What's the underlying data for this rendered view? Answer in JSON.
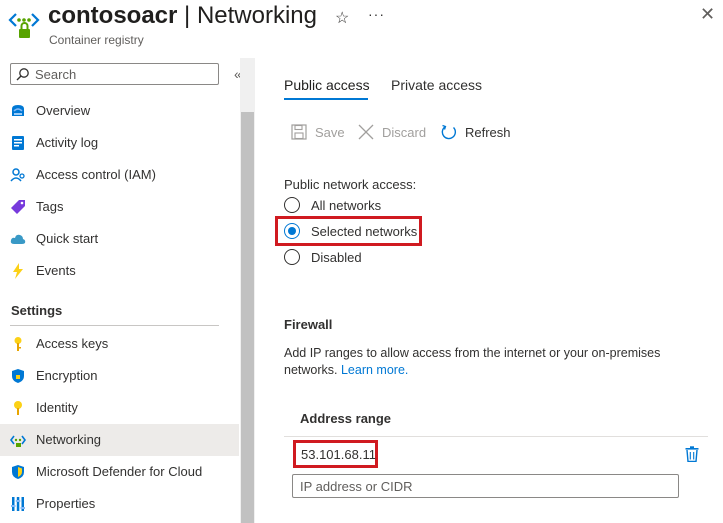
{
  "header": {
    "resource_name": "contosoacr",
    "separator": " | ",
    "page_name": "Networking",
    "subtitle": "Container registry",
    "icons": [
      "registry-icon",
      "star-icon",
      "more-icon",
      "close-icon"
    ]
  },
  "sidebar": {
    "search_placeholder": "Search",
    "collapse_glyph": "«",
    "items": [
      {
        "label": "Overview",
        "icon": "overview-icon"
      },
      {
        "label": "Activity log",
        "icon": "activity-log-icon"
      },
      {
        "label": "Access control (IAM)",
        "icon": "iam-icon"
      },
      {
        "label": "Tags",
        "icon": "tag-icon"
      },
      {
        "label": "Quick start",
        "icon": "cloud-icon"
      },
      {
        "label": "Events",
        "icon": "lightning-icon"
      }
    ],
    "settings_header": "Settings",
    "settings_items": [
      {
        "label": "Access keys",
        "icon": "key-icon"
      },
      {
        "label": "Encryption",
        "icon": "shield-lock-icon"
      },
      {
        "label": "Identity",
        "icon": "identity-icon"
      },
      {
        "label": "Networking",
        "icon": "networking-icon",
        "selected": true
      },
      {
        "label": "Microsoft Defender for Cloud",
        "icon": "defender-icon"
      },
      {
        "label": "Properties",
        "icon": "properties-icon"
      }
    ]
  },
  "tabs": [
    {
      "label": "Public access",
      "active": true
    },
    {
      "label": "Private access",
      "active": false
    }
  ],
  "toolbar": {
    "save": "Save",
    "discard": "Discard",
    "refresh": "Refresh"
  },
  "public_access": {
    "label": "Public network access:",
    "options": [
      {
        "label": "All networks",
        "checked": false
      },
      {
        "label": "Selected networks",
        "checked": true
      },
      {
        "label": "Disabled",
        "checked": false
      }
    ]
  },
  "firewall": {
    "title": "Firewall",
    "description": "Add IP ranges to allow access from the internet or your on-premises networks.",
    "learn_more": "Learn more.",
    "column_header": "Address range",
    "rows": [
      "53.101.68.11"
    ],
    "input_placeholder": "IP address or CIDR"
  },
  "colors": {
    "accent": "#0078d4",
    "highlight": "#d01a20",
    "selected_bg": "#edebe9"
  }
}
